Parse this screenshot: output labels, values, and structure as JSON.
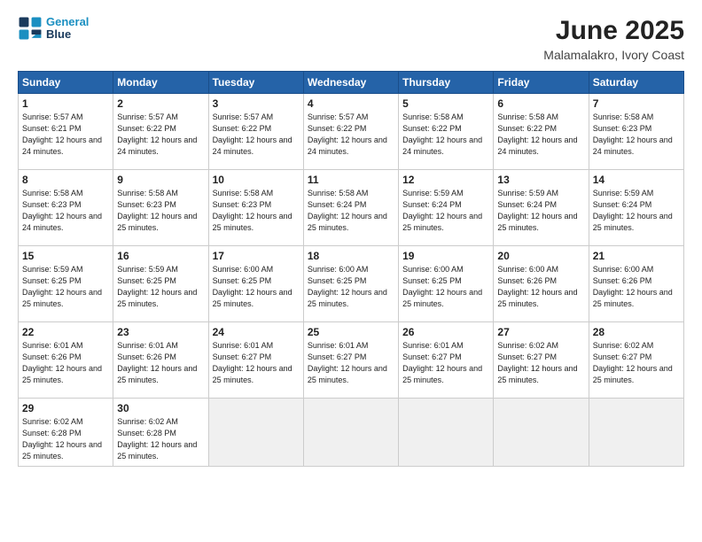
{
  "logo": {
    "line1": "General",
    "line2": "Blue"
  },
  "title": "June 2025",
  "subtitle": "Malamalakro, Ivory Coast",
  "days_header": [
    "Sunday",
    "Monday",
    "Tuesday",
    "Wednesday",
    "Thursday",
    "Friday",
    "Saturday"
  ],
  "weeks": [
    [
      {
        "day": "1",
        "info": "Sunrise: 5:57 AM\nSunset: 6:21 PM\nDaylight: 12 hours\nand 24 minutes."
      },
      {
        "day": "2",
        "info": "Sunrise: 5:57 AM\nSunset: 6:22 PM\nDaylight: 12 hours\nand 24 minutes."
      },
      {
        "day": "3",
        "info": "Sunrise: 5:57 AM\nSunset: 6:22 PM\nDaylight: 12 hours\nand 24 minutes."
      },
      {
        "day": "4",
        "info": "Sunrise: 5:57 AM\nSunset: 6:22 PM\nDaylight: 12 hours\nand 24 minutes."
      },
      {
        "day": "5",
        "info": "Sunrise: 5:58 AM\nSunset: 6:22 PM\nDaylight: 12 hours\nand 24 minutes."
      },
      {
        "day": "6",
        "info": "Sunrise: 5:58 AM\nSunset: 6:22 PM\nDaylight: 12 hours\nand 24 minutes."
      },
      {
        "day": "7",
        "info": "Sunrise: 5:58 AM\nSunset: 6:23 PM\nDaylight: 12 hours\nand 24 minutes."
      }
    ],
    [
      {
        "day": "8",
        "info": "Sunrise: 5:58 AM\nSunset: 6:23 PM\nDaylight: 12 hours\nand 24 minutes."
      },
      {
        "day": "9",
        "info": "Sunrise: 5:58 AM\nSunset: 6:23 PM\nDaylight: 12 hours\nand 25 minutes."
      },
      {
        "day": "10",
        "info": "Sunrise: 5:58 AM\nSunset: 6:23 PM\nDaylight: 12 hours\nand 25 minutes."
      },
      {
        "day": "11",
        "info": "Sunrise: 5:58 AM\nSunset: 6:24 PM\nDaylight: 12 hours\nand 25 minutes."
      },
      {
        "day": "12",
        "info": "Sunrise: 5:59 AM\nSunset: 6:24 PM\nDaylight: 12 hours\nand 25 minutes."
      },
      {
        "day": "13",
        "info": "Sunrise: 5:59 AM\nSunset: 6:24 PM\nDaylight: 12 hours\nand 25 minutes."
      },
      {
        "day": "14",
        "info": "Sunrise: 5:59 AM\nSunset: 6:24 PM\nDaylight: 12 hours\nand 25 minutes."
      }
    ],
    [
      {
        "day": "15",
        "info": "Sunrise: 5:59 AM\nSunset: 6:25 PM\nDaylight: 12 hours\nand 25 minutes."
      },
      {
        "day": "16",
        "info": "Sunrise: 5:59 AM\nSunset: 6:25 PM\nDaylight: 12 hours\nand 25 minutes."
      },
      {
        "day": "17",
        "info": "Sunrise: 6:00 AM\nSunset: 6:25 PM\nDaylight: 12 hours\nand 25 minutes."
      },
      {
        "day": "18",
        "info": "Sunrise: 6:00 AM\nSunset: 6:25 PM\nDaylight: 12 hours\nand 25 minutes."
      },
      {
        "day": "19",
        "info": "Sunrise: 6:00 AM\nSunset: 6:25 PM\nDaylight: 12 hours\nand 25 minutes."
      },
      {
        "day": "20",
        "info": "Sunrise: 6:00 AM\nSunset: 6:26 PM\nDaylight: 12 hours\nand 25 minutes."
      },
      {
        "day": "21",
        "info": "Sunrise: 6:00 AM\nSunset: 6:26 PM\nDaylight: 12 hours\nand 25 minutes."
      }
    ],
    [
      {
        "day": "22",
        "info": "Sunrise: 6:01 AM\nSunset: 6:26 PM\nDaylight: 12 hours\nand 25 minutes."
      },
      {
        "day": "23",
        "info": "Sunrise: 6:01 AM\nSunset: 6:26 PM\nDaylight: 12 hours\nand 25 minutes."
      },
      {
        "day": "24",
        "info": "Sunrise: 6:01 AM\nSunset: 6:27 PM\nDaylight: 12 hours\nand 25 minutes."
      },
      {
        "day": "25",
        "info": "Sunrise: 6:01 AM\nSunset: 6:27 PM\nDaylight: 12 hours\nand 25 minutes."
      },
      {
        "day": "26",
        "info": "Sunrise: 6:01 AM\nSunset: 6:27 PM\nDaylight: 12 hours\nand 25 minutes."
      },
      {
        "day": "27",
        "info": "Sunrise: 6:02 AM\nSunset: 6:27 PM\nDaylight: 12 hours\nand 25 minutes."
      },
      {
        "day": "28",
        "info": "Sunrise: 6:02 AM\nSunset: 6:27 PM\nDaylight: 12 hours\nand 25 minutes."
      }
    ],
    [
      {
        "day": "29",
        "info": "Sunrise: 6:02 AM\nSunset: 6:28 PM\nDaylight: 12 hours\nand 25 minutes."
      },
      {
        "day": "30",
        "info": "Sunrise: 6:02 AM\nSunset: 6:28 PM\nDaylight: 12 hours\nand 25 minutes."
      },
      {
        "day": "",
        "info": ""
      },
      {
        "day": "",
        "info": ""
      },
      {
        "day": "",
        "info": ""
      },
      {
        "day": "",
        "info": ""
      },
      {
        "day": "",
        "info": ""
      }
    ]
  ]
}
